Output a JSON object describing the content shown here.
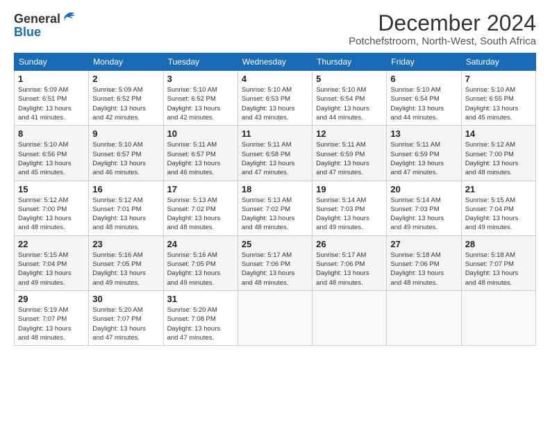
{
  "logo": {
    "line1": "General",
    "line2": "Blue"
  },
  "title": "December 2024",
  "subtitle": "Potchefstroom, North-West, South Africa",
  "days": [
    "Sunday",
    "Monday",
    "Tuesday",
    "Wednesday",
    "Thursday",
    "Friday",
    "Saturday"
  ],
  "weeks": [
    [
      {
        "date": "1",
        "info": "Sunrise: 5:09 AM\nSunset: 6:51 PM\nDaylight: 13 hours\nand 41 minutes."
      },
      {
        "date": "2",
        "info": "Sunrise: 5:09 AM\nSunset: 6:52 PM\nDaylight: 13 hours\nand 42 minutes."
      },
      {
        "date": "3",
        "info": "Sunrise: 5:10 AM\nSunset: 6:52 PM\nDaylight: 13 hours\nand 42 minutes."
      },
      {
        "date": "4",
        "info": "Sunrise: 5:10 AM\nSunset: 6:53 PM\nDaylight: 13 hours\nand 43 minutes."
      },
      {
        "date": "5",
        "info": "Sunrise: 5:10 AM\nSunset: 6:54 PM\nDaylight: 13 hours\nand 44 minutes."
      },
      {
        "date": "6",
        "info": "Sunrise: 5:10 AM\nSunset: 6:54 PM\nDaylight: 13 hours\nand 44 minutes."
      },
      {
        "date": "7",
        "info": "Sunrise: 5:10 AM\nSunset: 6:55 PM\nDaylight: 13 hours\nand 45 minutes."
      }
    ],
    [
      {
        "date": "8",
        "info": "Sunrise: 5:10 AM\nSunset: 6:56 PM\nDaylight: 13 hours\nand 45 minutes."
      },
      {
        "date": "9",
        "info": "Sunrise: 5:10 AM\nSunset: 6:57 PM\nDaylight: 13 hours\nand 46 minutes."
      },
      {
        "date": "10",
        "info": "Sunrise: 5:11 AM\nSunset: 6:57 PM\nDaylight: 13 hours\nand 46 minutes."
      },
      {
        "date": "11",
        "info": "Sunrise: 5:11 AM\nSunset: 6:58 PM\nDaylight: 13 hours\nand 47 minutes."
      },
      {
        "date": "12",
        "info": "Sunrise: 5:11 AM\nSunset: 6:59 PM\nDaylight: 13 hours\nand 47 minutes."
      },
      {
        "date": "13",
        "info": "Sunrise: 5:11 AM\nSunset: 6:59 PM\nDaylight: 13 hours\nand 47 minutes."
      },
      {
        "date": "14",
        "info": "Sunrise: 5:12 AM\nSunset: 7:00 PM\nDaylight: 13 hours\nand 48 minutes."
      }
    ],
    [
      {
        "date": "15",
        "info": "Sunrise: 5:12 AM\nSunset: 7:00 PM\nDaylight: 13 hours\nand 48 minutes."
      },
      {
        "date": "16",
        "info": "Sunrise: 5:12 AM\nSunset: 7:01 PM\nDaylight: 13 hours\nand 48 minutes."
      },
      {
        "date": "17",
        "info": "Sunrise: 5:13 AM\nSunset: 7:02 PM\nDaylight: 13 hours\nand 48 minutes."
      },
      {
        "date": "18",
        "info": "Sunrise: 5:13 AM\nSunset: 7:02 PM\nDaylight: 13 hours\nand 48 minutes."
      },
      {
        "date": "19",
        "info": "Sunrise: 5:14 AM\nSunset: 7:03 PM\nDaylight: 13 hours\nand 49 minutes."
      },
      {
        "date": "20",
        "info": "Sunrise: 5:14 AM\nSunset: 7:03 PM\nDaylight: 13 hours\nand 49 minutes."
      },
      {
        "date": "21",
        "info": "Sunrise: 5:15 AM\nSunset: 7:04 PM\nDaylight: 13 hours\nand 49 minutes."
      }
    ],
    [
      {
        "date": "22",
        "info": "Sunrise: 5:15 AM\nSunset: 7:04 PM\nDaylight: 13 hours\nand 49 minutes."
      },
      {
        "date": "23",
        "info": "Sunrise: 5:16 AM\nSunset: 7:05 PM\nDaylight: 13 hours\nand 49 minutes."
      },
      {
        "date": "24",
        "info": "Sunrise: 5:16 AM\nSunset: 7:05 PM\nDaylight: 13 hours\nand 49 minutes."
      },
      {
        "date": "25",
        "info": "Sunrise: 5:17 AM\nSunset: 7:06 PM\nDaylight: 13 hours\nand 48 minutes."
      },
      {
        "date": "26",
        "info": "Sunrise: 5:17 AM\nSunset: 7:06 PM\nDaylight: 13 hours\nand 48 minutes."
      },
      {
        "date": "27",
        "info": "Sunrise: 5:18 AM\nSunset: 7:06 PM\nDaylight: 13 hours\nand 48 minutes."
      },
      {
        "date": "28",
        "info": "Sunrise: 5:18 AM\nSunset: 7:07 PM\nDaylight: 13 hours\nand 48 minutes."
      }
    ],
    [
      {
        "date": "29",
        "info": "Sunrise: 5:19 AM\nSunset: 7:07 PM\nDaylight: 13 hours\nand 48 minutes."
      },
      {
        "date": "30",
        "info": "Sunrise: 5:20 AM\nSunset: 7:07 PM\nDaylight: 13 hours\nand 47 minutes."
      },
      {
        "date": "31",
        "info": "Sunrise: 5:20 AM\nSunset: 7:08 PM\nDaylight: 13 hours\nand 47 minutes."
      },
      null,
      null,
      null,
      null
    ]
  ]
}
